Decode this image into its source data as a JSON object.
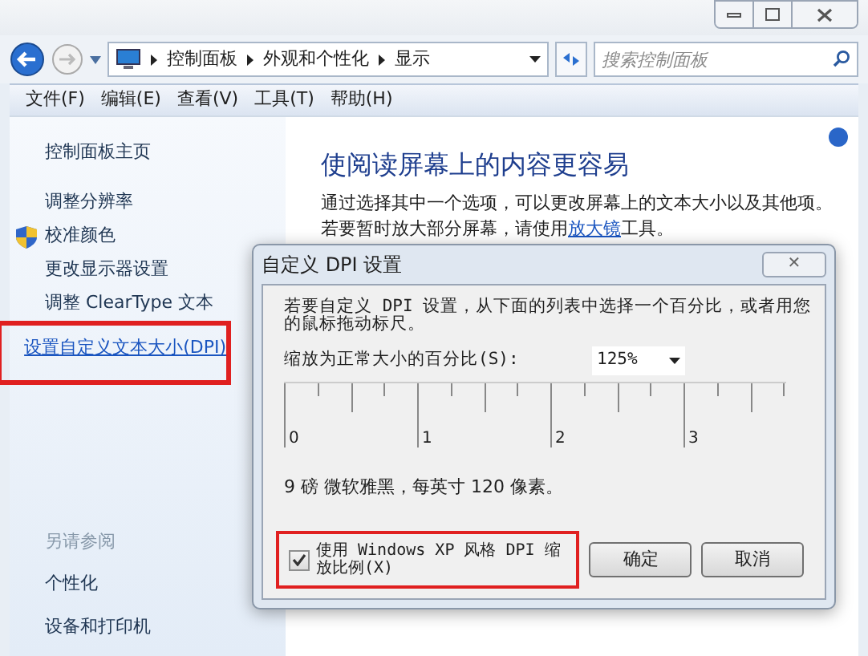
{
  "breadcrumb": [
    "控制面板",
    "外观和个性化",
    "显示"
  ],
  "search": {
    "placeholder": "搜索控制面板"
  },
  "menu": [
    "文件(F)",
    "编辑(E)",
    "查看(V)",
    "工具(T)",
    "帮助(H)"
  ],
  "sidebar": {
    "items": [
      {
        "label": "控制面板主页",
        "kind": "link",
        "highlighted": false
      },
      {
        "label": "调整分辨率",
        "kind": "link",
        "highlighted": false
      },
      {
        "label": "校准颜色",
        "kind": "shield",
        "highlighted": false
      },
      {
        "label": "更改显示器设置",
        "kind": "link",
        "highlighted": false
      },
      {
        "label": "调整 ClearType 文本",
        "kind": "link",
        "highlighted": false
      },
      {
        "label": "设置自定义文本大小(DPI)",
        "kind": "link",
        "highlighted": true
      }
    ],
    "see_also": {
      "title": "另请参阅",
      "items": [
        "个性化",
        "设备和打印机"
      ]
    }
  },
  "main": {
    "heading": "使阅读屏幕上的内容更容易",
    "text": "通过选择其中一个选项，可以更改屏幕上的文本大小以及其他项。若要暂时放大部分屏幕，请使用",
    "link": "放大镜",
    "text_end": "工具。"
  },
  "dialog": {
    "title": "自定义 DPI 设置",
    "close": "✕",
    "instructions": "若要自定义 DPI 设置，从下面的列表中选择一个百分比，或者用您的鼠标拖动标尺。",
    "scale_label": "缩放为正常大小的百分比(S):",
    "scale_value": "125%",
    "ruler_labels": [
      "0",
      "1",
      "2",
      "3"
    ],
    "sample": "9 磅 微软雅黑，每英寸 120 像素。",
    "xp_checkbox": {
      "label": "使用 Windows XP 风格 DPI 缩放比例(X)",
      "checked": true,
      "highlighted": true
    },
    "buttons": [
      "确定",
      "取消"
    ]
  }
}
